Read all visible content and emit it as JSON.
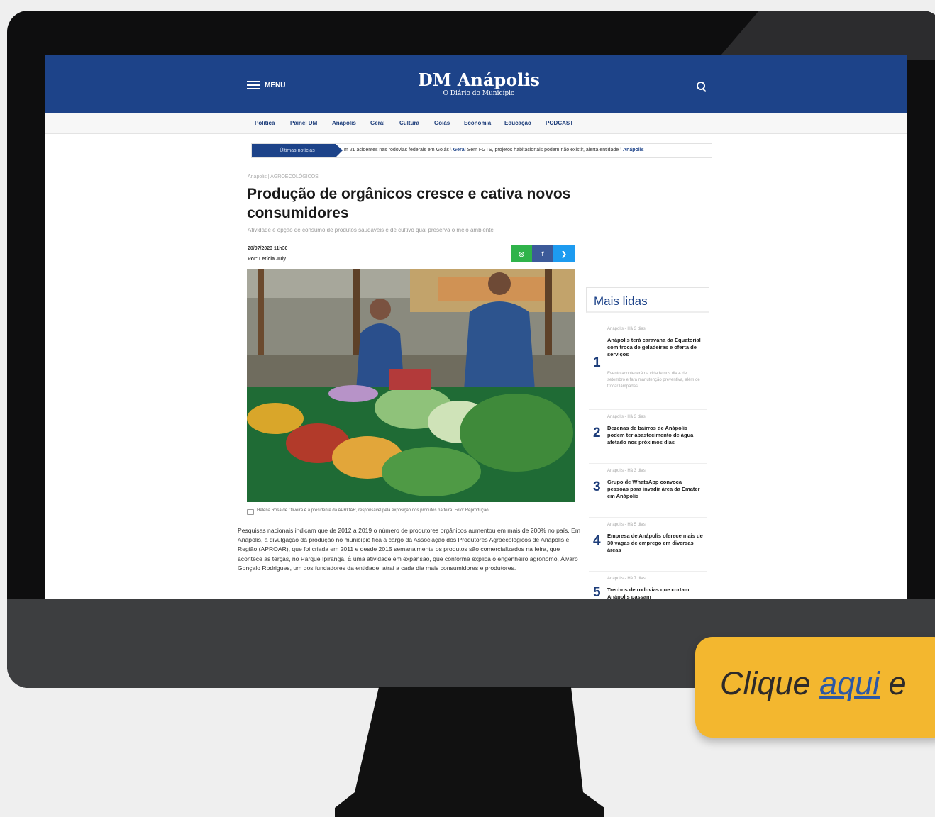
{
  "header": {
    "menu_label": "MENU",
    "brand_name": "DM Anápolis",
    "brand_tagline": "O Diário do Município"
  },
  "categories": [
    "Política",
    "Painel DM",
    "Anápolis",
    "Geral",
    "Cultura",
    "Goiás",
    "Economia",
    "Educação",
    "PODCAST"
  ],
  "ticker": {
    "label": "Últimas notícias",
    "items": [
      {
        "category": "",
        "text": "m 21 acidentes nas rodovias federais em Goiás"
      },
      {
        "category": "Geral",
        "text": "Sem FGTS, projetos habitacionais podem não existir, alerta entidade"
      },
      {
        "category": "Anápolis",
        "text": ""
      }
    ]
  },
  "article": {
    "breadcrumb": "Anápolis | AGROECOLÓGICOS",
    "title": "Produção de orgânicos cresce e cativa novos consumidores",
    "subtitle": "Atividade é opção de consumo de produtos saudáveis e de cultivo qual preserva o meio ambiente",
    "date": "20/07/2023 11h30",
    "author": "Por: Letícia July",
    "caption": "Helena Rosa de Oliveira é a presidente da APROAR, responsável pela exposição dos produtos na feira. Foto: Reprodução",
    "body": "Pesquisas nacionais indicam que de 2012 a 2019 o número de produtores orgânicos aumentou em mais de 200% no país. Em Anápolis, a divulgação da produção no município fica a cargo da Associação dos Produtores Agroecológicos de Anápolis e Região (APROAR), que foi criada em 2011 e desde 2015 semanalmente os produtos são comercializados na feira, que acontece às terças, no Parque Ipiranga. É uma atividade em expansão, que conforme explica o engenheiro agrônomo, Álvaro Gonçalo Rodrigues, um dos fundadores da entidade, atrai a cada dia mais consumidores e produtores."
  },
  "share": {
    "whatsapp": "◎",
    "facebook": "f",
    "twitter": "❯"
  },
  "mais_lidas": {
    "title": "Mais lidas",
    "items": [
      {
        "rank": "1",
        "meta": "Anápolis - Há 3 dias",
        "title": "Anápolis terá caravana da Equatorial com troca de geladeiras e oferta de serviços",
        "desc": "Evento acontecerá na cidade nos dia 4 de setembro e fará manutenção preventiva, além de trocar lâmpadas"
      },
      {
        "rank": "2",
        "meta": "Anápolis - Há 3 dias",
        "title": "Dezenas de bairros de Anápolis podem ter abastecimento de água afetado nos próximos dias",
        "desc": ""
      },
      {
        "rank": "3",
        "meta": "Anápolis - Há 3 dias",
        "title": "Grupo de WhatsApp convoca pessoas para invadir área da Emater em Anápolis",
        "desc": ""
      },
      {
        "rank": "4",
        "meta": "Anápolis - Há 5 dias",
        "title": "Empresa de Anápolis oferece mais de 30 vagas de emprego em diversas áreas",
        "desc": ""
      },
      {
        "rank": "5",
        "meta": "Anápolis - Há 7 dias",
        "title": "Trechos de rodovias que cortam Anápolis passam",
        "desc": ""
      }
    ]
  },
  "cta": {
    "before": "Clique ",
    "link": "aqui",
    "after": " e"
  },
  "colors": {
    "brand_blue": "#1d4389",
    "cta_yellow": "#f3b72f",
    "whatsapp": "#2fb34a",
    "facebook": "#3c5a99",
    "twitter": "#1d9bf0"
  }
}
